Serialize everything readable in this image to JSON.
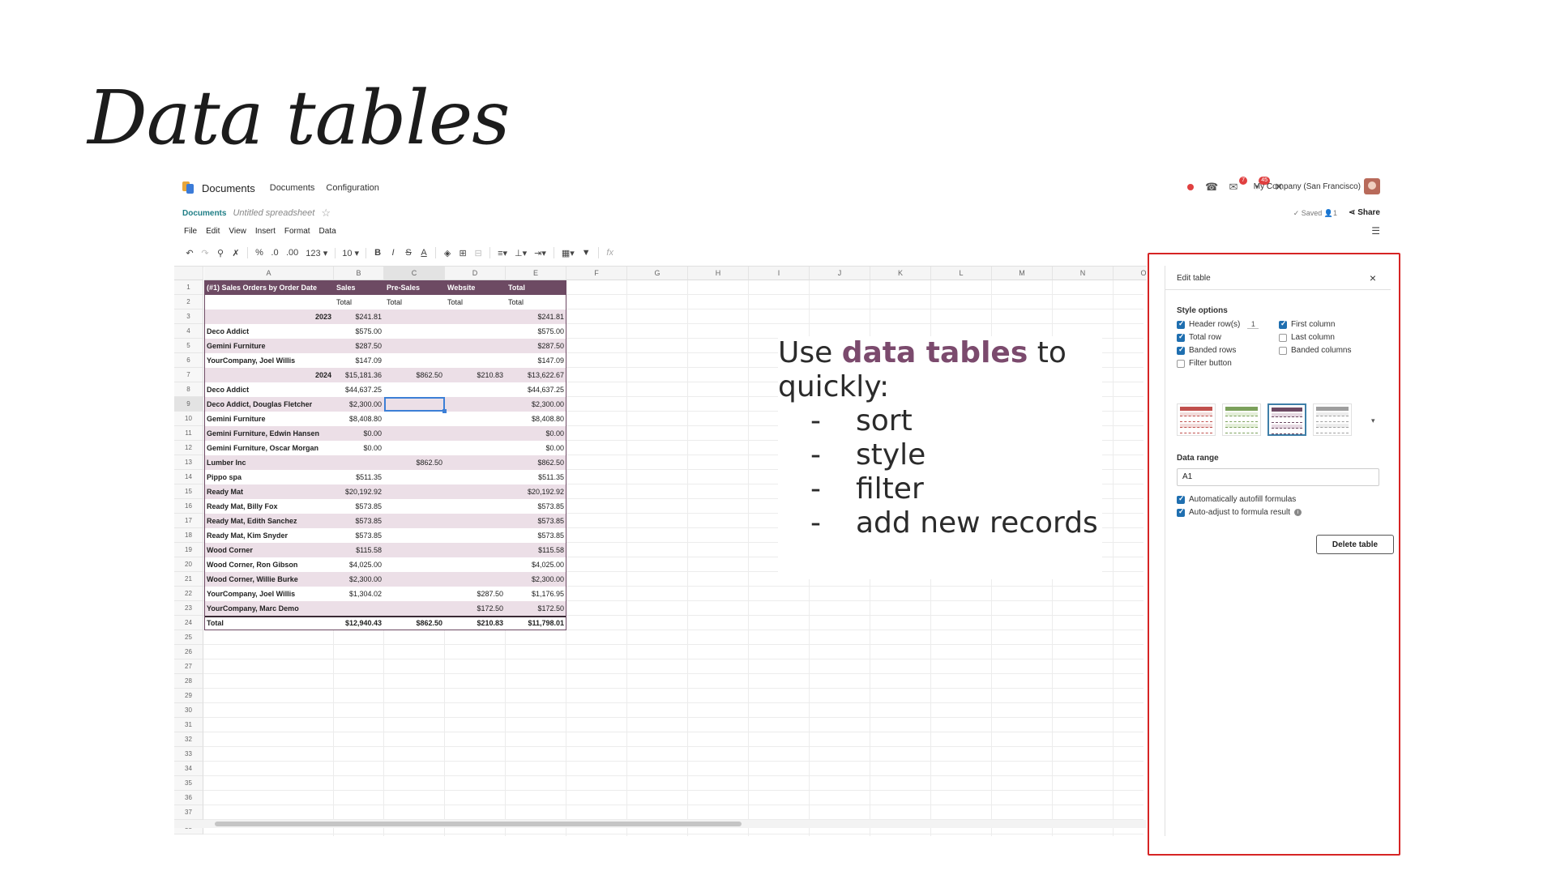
{
  "slide": {
    "title": "Data tables"
  },
  "navbar": {
    "app_name": "Documents",
    "menus": [
      "Documents",
      "Configuration"
    ],
    "company": "My Company (San Francisco)",
    "badges": {
      "chat": "7",
      "activity": "45"
    }
  },
  "breadcrumb": {
    "parent": "Documents",
    "current": "Untitled spreadsheet"
  },
  "status": {
    "saved": "✓ Saved  👤1",
    "share": "Share"
  },
  "menubar": [
    "File",
    "Edit",
    "View",
    "Insert",
    "Format",
    "Data"
  ],
  "toolbar": {
    "percent": "%",
    "dec_less": ".0",
    "dec_more": ".00",
    "format": "123 ▾",
    "font_size": "10",
    "bold": "B",
    "italic": "I",
    "strike": "S",
    "text_color": "A"
  },
  "grid": {
    "columns": [
      "A",
      "B",
      "C",
      "D",
      "E",
      "F",
      "G",
      "H",
      "I",
      "J",
      "K",
      "L",
      "M",
      "N",
      "O"
    ],
    "rows_count": 38,
    "table_rows": [
      {
        "kind": "hdr",
        "a": "(#1) Sales Orders by Order Date",
        "b": "Sales",
        "c": "Pre-Sales",
        "d": "Website",
        "e": "Total"
      },
      {
        "kind": "even",
        "a": "",
        "b": "Total",
        "c": "Total",
        "d": "Total",
        "e": "Total",
        "sub": true
      },
      {
        "kind": "odd",
        "a": "2023",
        "b": "$241.81",
        "c": "",
        "d": "",
        "e": "$241.81",
        "year": true
      },
      {
        "kind": "even",
        "a": "Deco Addict",
        "b": "$575.00",
        "c": "",
        "d": "",
        "e": "$575.00"
      },
      {
        "kind": "odd",
        "a": "Gemini Furniture",
        "b": "$287.50",
        "c": "",
        "d": "",
        "e": "$287.50"
      },
      {
        "kind": "even",
        "a": "YourCompany, Joel Willis",
        "b": "$147.09",
        "c": "",
        "d": "",
        "e": "$147.09"
      },
      {
        "kind": "odd",
        "a": "2024",
        "b": "$15,181.36",
        "c": "$862.50",
        "d": "$210.83",
        "e": "$13,622.67",
        "year": true
      },
      {
        "kind": "even",
        "a": "Deco Addict",
        "b": "$44,637.25",
        "c": "",
        "d": "",
        "e": "$44,637.25"
      },
      {
        "kind": "odd",
        "a": "Deco Addict, Douglas Fletcher",
        "b": "$2,300.00",
        "c": "",
        "d": "",
        "e": "$2,300.00"
      },
      {
        "kind": "even",
        "a": "Gemini Furniture",
        "b": "$8,408.80",
        "c": "",
        "d": "",
        "e": "$8,408.80"
      },
      {
        "kind": "odd",
        "a": "Gemini Furniture, Edwin Hansen",
        "b": "$0.00",
        "c": "",
        "d": "",
        "e": "$0.00"
      },
      {
        "kind": "even",
        "a": "Gemini Furniture, Oscar Morgan",
        "b": "$0.00",
        "c": "",
        "d": "",
        "e": "$0.00"
      },
      {
        "kind": "odd",
        "a": "Lumber Inc",
        "b": "",
        "c": "$862.50",
        "d": "",
        "e": "$862.50"
      },
      {
        "kind": "even",
        "a": "Pippo spa",
        "b": "$511.35",
        "c": "",
        "d": "",
        "e": "$511.35"
      },
      {
        "kind": "odd",
        "a": "Ready Mat",
        "b": "$20,192.92",
        "c": "",
        "d": "",
        "e": "$20,192.92"
      },
      {
        "kind": "even",
        "a": "Ready Mat, Billy Fox",
        "b": "$573.85",
        "c": "",
        "d": "",
        "e": "$573.85"
      },
      {
        "kind": "odd",
        "a": "Ready Mat, Edith Sanchez",
        "b": "$573.85",
        "c": "",
        "d": "",
        "e": "$573.85"
      },
      {
        "kind": "even",
        "a": "Ready Mat, Kim Snyder",
        "b": "$573.85",
        "c": "",
        "d": "",
        "e": "$573.85"
      },
      {
        "kind": "odd",
        "a": "Wood Corner",
        "b": "$115.58",
        "c": "",
        "d": "",
        "e": "$115.58"
      },
      {
        "kind": "even",
        "a": "Wood Corner, Ron Gibson",
        "b": "$4,025.00",
        "c": "",
        "d": "",
        "e": "$4,025.00"
      },
      {
        "kind": "odd",
        "a": "Wood Corner, Willie Burke",
        "b": "$2,300.00",
        "c": "",
        "d": "",
        "e": "$2,300.00"
      },
      {
        "kind": "even",
        "a": "YourCompany, Joel Willis",
        "b": "$1,304.02",
        "c": "",
        "d": "$287.50",
        "e": "$1,176.95"
      },
      {
        "kind": "odd",
        "a": "YourCompany, Marc Demo",
        "b": "",
        "c": "",
        "d": "$172.50",
        "e": "$172.50"
      },
      {
        "kind": "tot",
        "a": "Total",
        "b": "$12,940.43",
        "c": "$862.50",
        "d": "$210.83",
        "e": "$11,798.01"
      }
    ]
  },
  "callout": {
    "line1_pre": "Use ",
    "line1_highlight": "data tables",
    "line1_post": " to",
    "line2": "quickly:",
    "bullets": [
      "sort",
      "style",
      "filter",
      "add new records"
    ]
  },
  "side_panel": {
    "title": "Edit table",
    "style_options_title": "Style options",
    "header_rows_count": "1",
    "options_left": [
      {
        "label": "Header row(s)",
        "checked": true
      },
      {
        "label": "Total row",
        "checked": true
      },
      {
        "label": "Banded rows",
        "checked": true
      },
      {
        "label": "Filter button",
        "checked": false
      }
    ],
    "options_right": [
      {
        "label": "First column",
        "checked": true
      },
      {
        "label": "Last column",
        "checked": false
      },
      {
        "label": "Banded columns",
        "checked": false
      }
    ],
    "table_styles": [
      {
        "color": "#c0504d",
        "light": "#f2dcdb"
      },
      {
        "color": "#7ba05b",
        "light": "#e4efd9"
      },
      {
        "color": "#6d4a63",
        "light": "#e6d9e2",
        "selected": true
      },
      {
        "color": "#9e9e9e",
        "light": "#ededed"
      }
    ],
    "data_range_title": "Data range",
    "data_range_value": "A1",
    "auto_options": [
      {
        "label": "Automatically autofill formulas",
        "checked": true
      },
      {
        "label": "Auto-adjust to formula result",
        "checked": true
      }
    ],
    "delete_label": "Delete table"
  },
  "colors": {
    "accent": "#6d4a63",
    "band": "#ecdfe7",
    "highlight": "#d62424",
    "link": "#1f7e86"
  }
}
